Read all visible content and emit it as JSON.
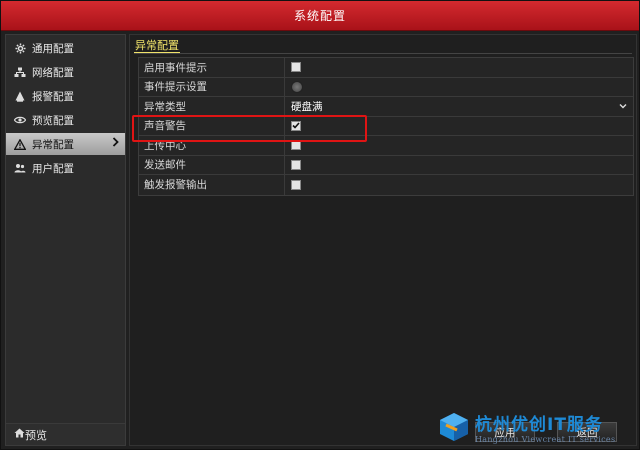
{
  "window": {
    "title": "系统配置"
  },
  "sidebar": {
    "items": [
      {
        "label": "通用配置",
        "icon": "gear-icon"
      },
      {
        "label": "网络配置",
        "icon": "network-icon"
      },
      {
        "label": "报警配置",
        "icon": "alarm-icon"
      },
      {
        "label": "预览配置",
        "icon": "eye-icon"
      },
      {
        "label": "异常配置",
        "icon": "warning-icon",
        "active": true
      },
      {
        "label": "用户配置",
        "icon": "users-icon"
      }
    ],
    "bottom": {
      "label": "预览",
      "icon": "home-icon"
    }
  },
  "main": {
    "section_title": "异常配置",
    "rows": [
      {
        "label": "启用事件提示",
        "type": "checkbox",
        "checked": false
      },
      {
        "label": "事件提示设置",
        "type": "gear-button"
      },
      {
        "label": "异常类型",
        "type": "select",
        "value": "硬盘满"
      },
      {
        "label": "声音警告",
        "type": "checkbox",
        "checked": true
      },
      {
        "label": "上传中心",
        "type": "checkbox",
        "checked": false
      },
      {
        "label": "发送邮件",
        "type": "checkbox",
        "checked": false
      },
      {
        "label": "触发报警输出",
        "type": "checkbox",
        "checked": false
      }
    ],
    "buttons": {
      "apply": "应用",
      "back": "返回"
    }
  },
  "watermark": {
    "cn": "杭州优创IT服务",
    "en": "Hangzhou Viewcreat IT services"
  },
  "colors": {
    "titlebar": "#c41c22",
    "highlight": "#e01414",
    "section_title": "#f0e36a",
    "watermark": "#1e8ad6"
  }
}
